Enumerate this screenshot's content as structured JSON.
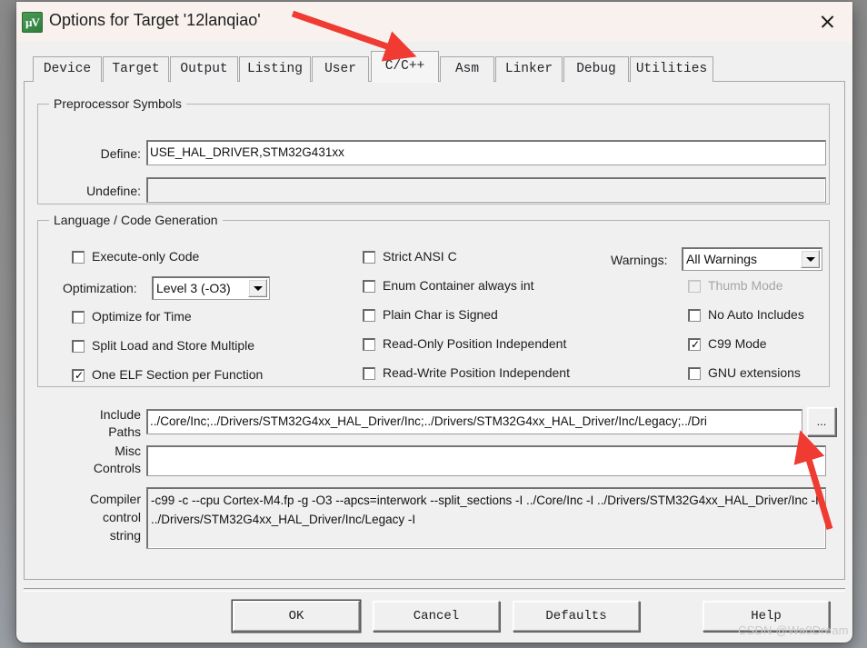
{
  "window": {
    "title": "Options for Target '12lanqiao'",
    "icon": "uvision-logo-icon",
    "close_label": "✕"
  },
  "tabs": [
    {
      "label": "Device",
      "active": false
    },
    {
      "label": "Target",
      "active": false
    },
    {
      "label": "Output",
      "active": false
    },
    {
      "label": "Listing",
      "active": false
    },
    {
      "label": "User",
      "active": false
    },
    {
      "label": "C/C++",
      "active": true
    },
    {
      "label": "Asm",
      "active": false
    },
    {
      "label": "Linker",
      "active": false
    },
    {
      "label": "Debug",
      "active": false
    },
    {
      "label": "Utilities",
      "active": false
    }
  ],
  "preprocessor": {
    "legend": "Preprocessor Symbols",
    "define_label": "Define:",
    "define_value": "USE_HAL_DRIVER,STM32G431xx",
    "undefine_label": "Undefine:",
    "undefine_value": ""
  },
  "language": {
    "legend": "Language / Code Generation",
    "optimization_label": "Optimization:",
    "optimization_value": "Level 3 (-O3)",
    "warnings_label": "Warnings:",
    "warnings_value": "All Warnings",
    "col1": [
      {
        "label": "Execute-only Code",
        "checked": false,
        "disabled": false
      },
      {
        "label": "Optimize for Time",
        "checked": false,
        "disabled": false
      },
      {
        "label": "Split Load and Store Multiple",
        "checked": false,
        "disabled": false
      },
      {
        "label": "One ELF Section per Function",
        "checked": true,
        "disabled": false
      }
    ],
    "col2": [
      {
        "label": "Strict ANSI C",
        "checked": false,
        "disabled": false
      },
      {
        "label": "Enum Container always int",
        "checked": false,
        "disabled": false
      },
      {
        "label": "Plain Char is Signed",
        "checked": false,
        "disabled": false
      },
      {
        "label": "Read-Only Position Independent",
        "checked": false,
        "disabled": false
      },
      {
        "label": "Read-Write Position Independent",
        "checked": false,
        "disabled": false
      }
    ],
    "col3": [
      {
        "label": "Thumb Mode",
        "checked": false,
        "disabled": true
      },
      {
        "label": "No Auto Includes",
        "checked": false,
        "disabled": false
      },
      {
        "label": "C99 Mode",
        "checked": true,
        "disabled": false
      },
      {
        "label": "GNU extensions",
        "checked": false,
        "disabled": false
      }
    ]
  },
  "paths": {
    "include_label_line1": "Include",
    "include_label_line2": "Paths",
    "include_value": "../Core/Inc;../Drivers/STM32G4xx_HAL_Driver/Inc;../Drivers/STM32G4xx_HAL_Driver/Inc/Legacy;../Dri",
    "browse_label": "...",
    "misc_label_line1": "Misc",
    "misc_label_line2": "Controls",
    "misc_value": "",
    "compiler_label_line1": "Compiler",
    "compiler_label_line2": "control",
    "compiler_label_line3": "string",
    "compiler_value": "-c99 -c --cpu Cortex-M4.fp -g -O3 --apcs=interwork --split_sections -I ../Core/Inc -I ../Drivers/STM32G4xx_HAL_Driver/Inc -I ../Drivers/STM32G4xx_HAL_Driver/Inc/Legacy -I"
  },
  "footer": {
    "ok_label": "OK",
    "cancel_label": "Cancel",
    "defaults_label": "Defaults",
    "help_label": "Help"
  },
  "annotations": {
    "arrow_color": "#ef3b32",
    "watermark": "CSDN @Wa0Dream"
  }
}
